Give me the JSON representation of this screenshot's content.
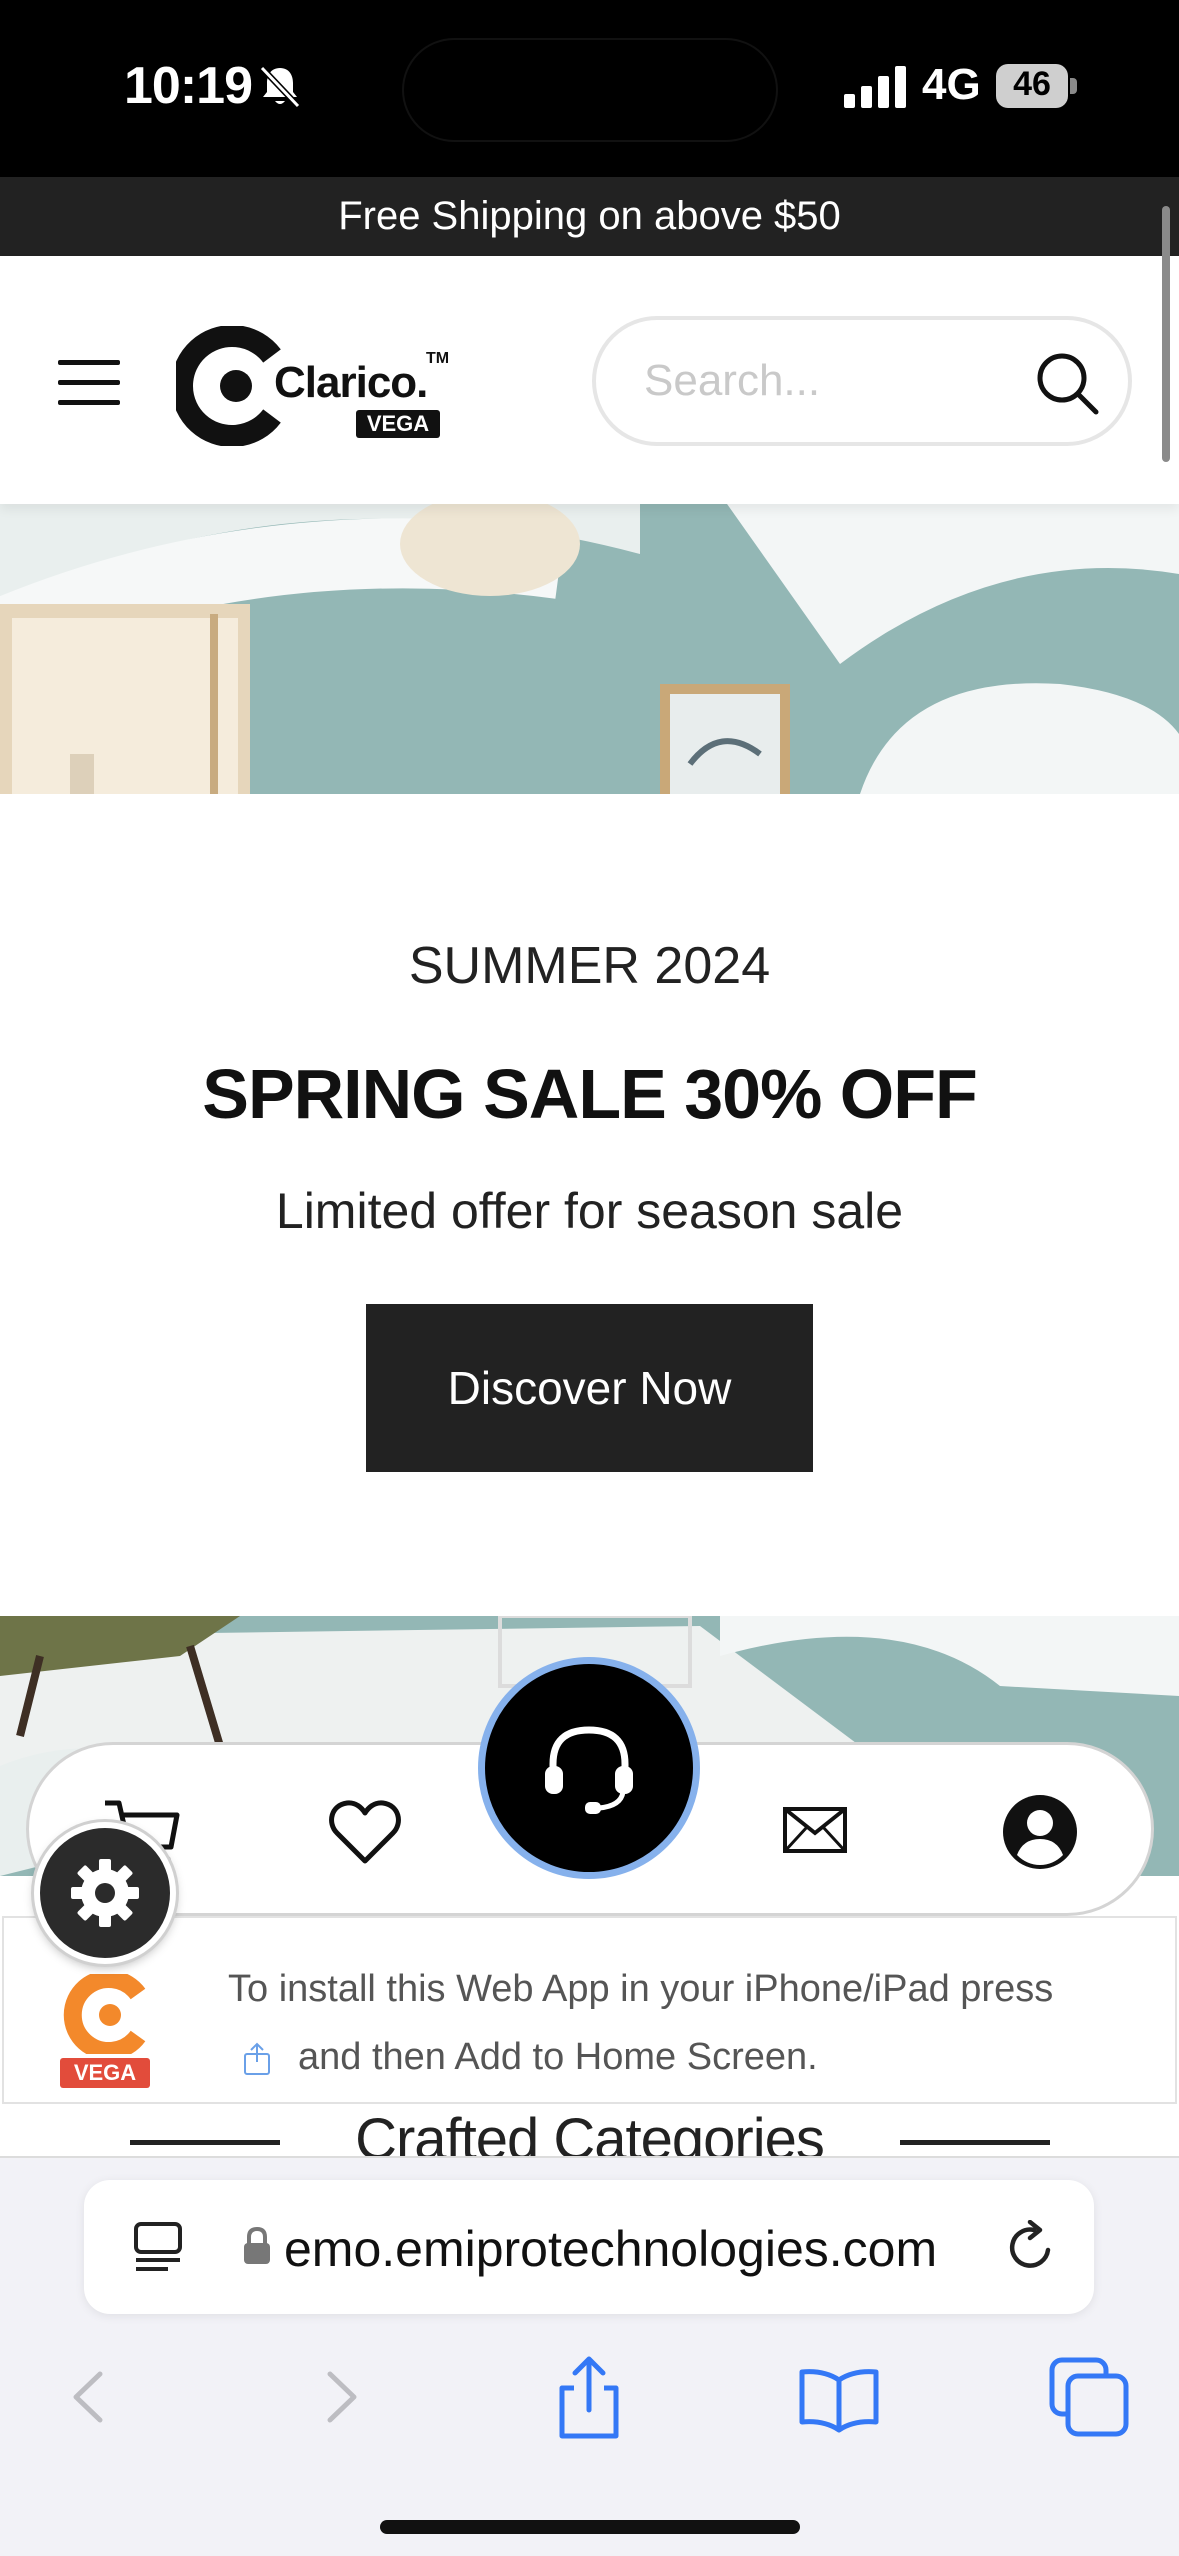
{
  "status_bar": {
    "time": "10:19",
    "network": "4G",
    "battery": "46"
  },
  "announcement": {
    "text": "Free Shipping on above $50"
  },
  "header": {
    "logo_text": "Clarico.",
    "logo_tm": "TM",
    "logo_badge": "VEGA",
    "search_placeholder": "Search..."
  },
  "hero": {
    "eyebrow": "SUMMER 2024",
    "title": "SPRING SALE 30% OFF",
    "subtitle": "Limited offer for season sale",
    "button_label": "Discover Now"
  },
  "install_banner": {
    "line1": "To install this Web App in your iPhone/iPad press",
    "line2": "and then Add to Home Screen.",
    "icon_badge": "VEGA"
  },
  "categories": {
    "heading": "Crafted Categories"
  },
  "browser": {
    "url": "emo.emiprotechnologies.com"
  },
  "colors": {
    "accent_dark": "#222222",
    "support_ring": "#86b1ec",
    "hero_bg": "#8fb3b2",
    "ios_blue": "#3478f6",
    "app_icon_orange": "#f3892b",
    "app_icon_red": "#e24c3b"
  },
  "icons": {
    "bottom_nav": [
      "cart-icon",
      "heart-icon",
      "headset-icon",
      "mail-icon",
      "account-icon"
    ],
    "floating": "gear-icon",
    "safari_toolbar": [
      "back-icon",
      "forward-icon",
      "share-icon",
      "bookmarks-icon",
      "tabs-icon"
    ]
  }
}
